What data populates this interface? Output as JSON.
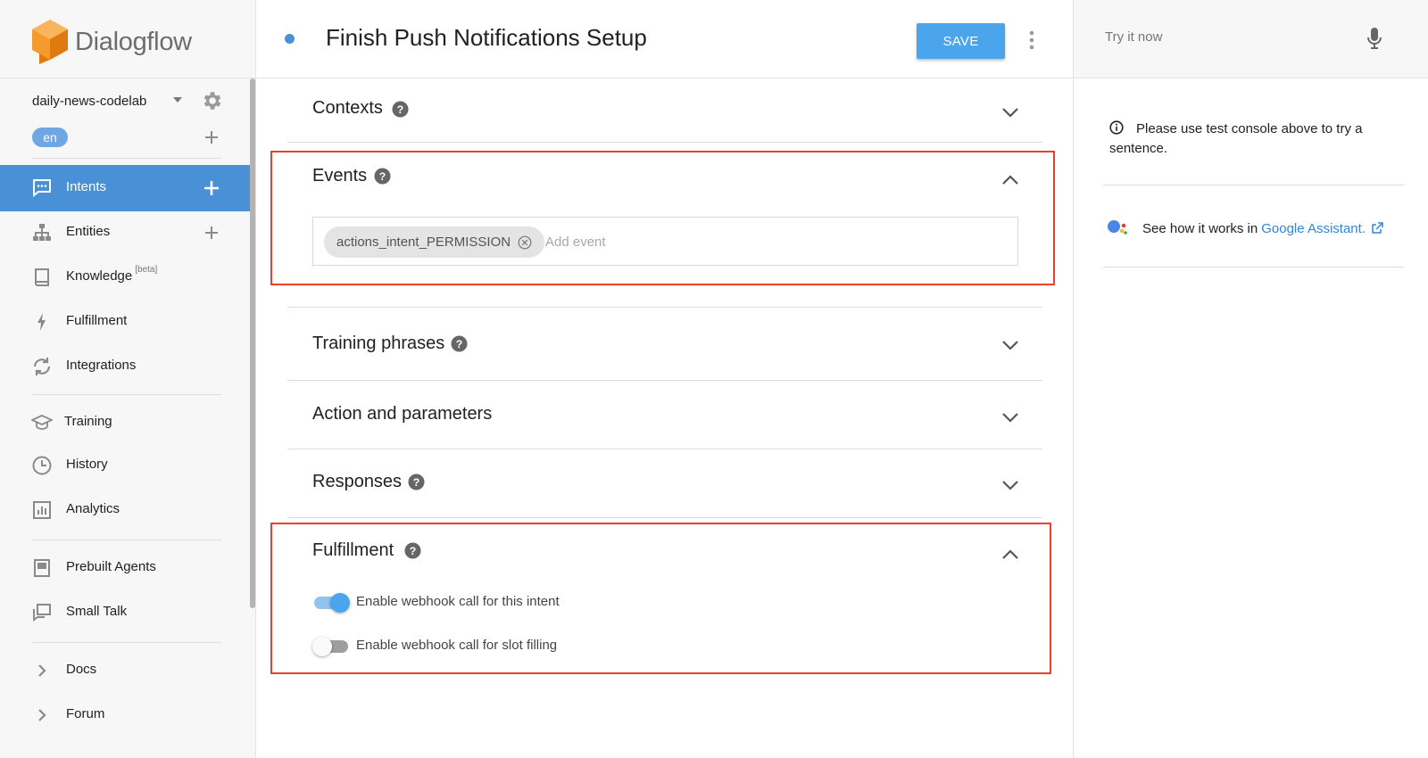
{
  "app": {
    "name": "Dialogflow"
  },
  "sidebar": {
    "agent_name": "daily-news-codelab",
    "language": "en",
    "items": [
      {
        "label": "Intents",
        "icon": "chat-icon",
        "active": true,
        "has_add": true
      },
      {
        "label": "Entities",
        "icon": "hierarchy-icon",
        "has_add": true
      },
      {
        "label": "Knowledge",
        "badge": "[beta]",
        "icon": "book-icon"
      },
      {
        "label": "Fulfillment",
        "icon": "bolt-icon"
      },
      {
        "label": "Integrations",
        "icon": "sync-icon"
      },
      {
        "label": "Training",
        "icon": "graduation-cap-icon"
      },
      {
        "label": "History",
        "icon": "clock-icon"
      },
      {
        "label": "Analytics",
        "icon": "bar-chart-icon"
      },
      {
        "label": "Prebuilt Agents",
        "icon": "prebuilt-book-icon"
      },
      {
        "label": "Small Talk",
        "icon": "chat-bubbles-icon"
      },
      {
        "label": "Docs",
        "icon": "chevron-right-icon"
      },
      {
        "label": "Forum",
        "icon": "chevron-right-icon"
      }
    ]
  },
  "header": {
    "intent_title": "Finish Push Notifications Setup",
    "save_label": "SAVE"
  },
  "sections": {
    "contexts": {
      "title": "Contexts",
      "expanded": false
    },
    "events": {
      "title": "Events",
      "expanded": true,
      "chips": [
        "actions_intent_PERMISSION"
      ],
      "add_placeholder": "Add event"
    },
    "training": {
      "title": "Training phrases",
      "expanded": false
    },
    "action": {
      "title": "Action and parameters",
      "expanded": false
    },
    "responses": {
      "title": "Responses",
      "expanded": false
    },
    "fulfillment": {
      "title": "Fulfillment",
      "expanded": true,
      "toggles": [
        {
          "label": "Enable webhook call for this intent",
          "on": true
        },
        {
          "label": "Enable webhook call for slot filling",
          "on": false
        }
      ]
    }
  },
  "right_panel": {
    "try_placeholder": "Try it now",
    "info_text": "Please use test console above to try a sentence.",
    "assistant_prefix": "See how it works in",
    "assistant_link": "Google Assistant",
    "assistant_suffix": "."
  },
  "colors": {
    "accent": "#4a90d6",
    "save_button": "#4aa5ec",
    "highlight_border": "#e8412c",
    "logo_orange": "#f59a2c"
  }
}
